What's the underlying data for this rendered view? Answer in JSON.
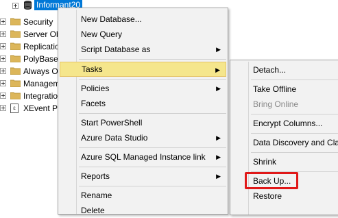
{
  "tree": {
    "database_label": "Informant20",
    "items": [
      {
        "label": "Security"
      },
      {
        "label": "Server Ob"
      },
      {
        "label": "Replicatio"
      },
      {
        "label": "PolyBase"
      },
      {
        "label": "Always O"
      },
      {
        "label": "Managem"
      },
      {
        "label": "Integratio"
      },
      {
        "label": "XEvent Pr"
      }
    ]
  },
  "context_menu": {
    "items": [
      {
        "label": "New Database..."
      },
      {
        "label": "New Query"
      },
      {
        "label": "Script Database as",
        "arrow": "▶"
      },
      {
        "label": "Tasks",
        "arrow": "▶"
      },
      {
        "label": "Policies",
        "arrow": "▶"
      },
      {
        "label": "Facets"
      },
      {
        "label": "Start PowerShell"
      },
      {
        "label": "Azure Data Studio",
        "arrow": "▶"
      },
      {
        "label": "Azure SQL Managed Instance link",
        "arrow": "▶"
      },
      {
        "label": "Reports",
        "arrow": "▶"
      },
      {
        "label": "Rename"
      },
      {
        "label": "Delete"
      }
    ]
  },
  "tasks_submenu": {
    "items": [
      {
        "label": "Detach..."
      },
      {
        "label": "Take Offline"
      },
      {
        "label": "Bring Online"
      },
      {
        "label": "Encrypt Columns..."
      },
      {
        "label": "Data Discovery and Clas"
      },
      {
        "label": "Shrink"
      },
      {
        "label": "Back Up..."
      },
      {
        "label": "Restore"
      }
    ]
  },
  "colors": {
    "selection": "#0078d7",
    "highlight": "#f5e68c",
    "callout": "#e01818",
    "folder": "#dcb65a"
  }
}
